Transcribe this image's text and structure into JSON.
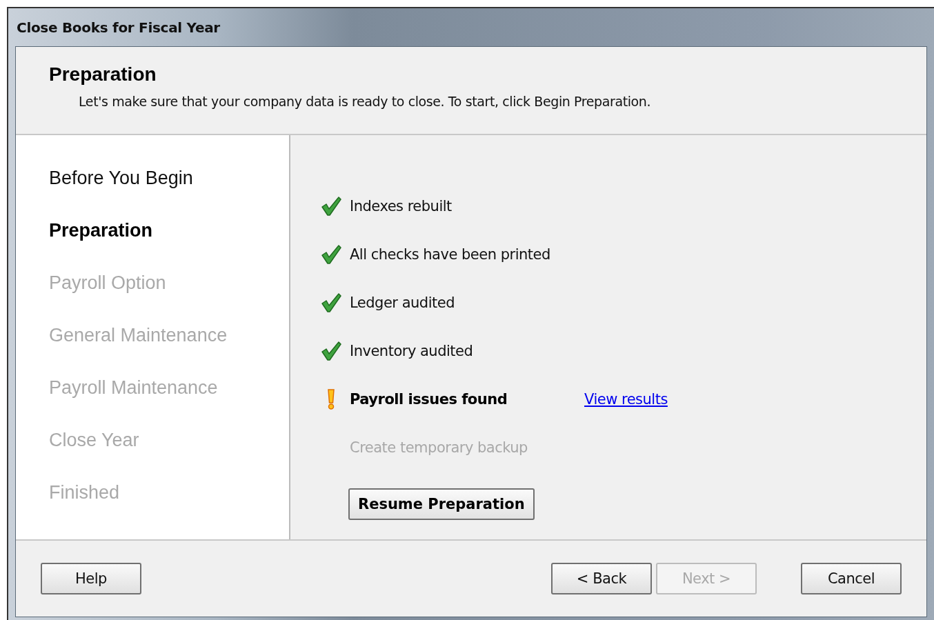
{
  "window": {
    "title": "Close Books for Fiscal Year"
  },
  "header": {
    "title": "Preparation",
    "description": "Let's make sure that your company data is ready to close. To start, click Begin Preparation."
  },
  "steps": [
    {
      "label": "Before You Begin",
      "selected": false,
      "completed": true
    },
    {
      "label": "Preparation",
      "selected": true,
      "completed": false
    },
    {
      "label": "Payroll Option",
      "selected": false,
      "completed": false
    },
    {
      "label": "General Maintenance",
      "selected": false,
      "completed": false
    },
    {
      "label": "Payroll Maintenance",
      "selected": false,
      "completed": false
    },
    {
      "label": "Close Year",
      "selected": false,
      "completed": false
    },
    {
      "label": "Finished",
      "selected": false,
      "completed": false
    }
  ],
  "checklist": [
    {
      "label": "Indexes rebuilt",
      "kind": "ok"
    },
    {
      "label": "All checks have been printed",
      "kind": "ok"
    },
    {
      "label": "Ledger audited",
      "kind": "ok"
    },
    {
      "label": "Inventory audited",
      "kind": "ok"
    },
    {
      "label": "Payroll issues found",
      "kind": "warning",
      "link": "View results"
    },
    {
      "label": "Create temporary backup",
      "kind": "pending"
    }
  ],
  "action_button": {
    "label": "Resume Preparation"
  },
  "footer": {
    "help": {
      "label": "Help",
      "disabled": false
    },
    "buttons": [
      {
        "label": "< Back",
        "disabled": false
      },
      {
        "label": "Next >",
        "disabled": true
      }
    ],
    "cancel": {
      "label": "Cancel",
      "disabled": false
    }
  }
}
